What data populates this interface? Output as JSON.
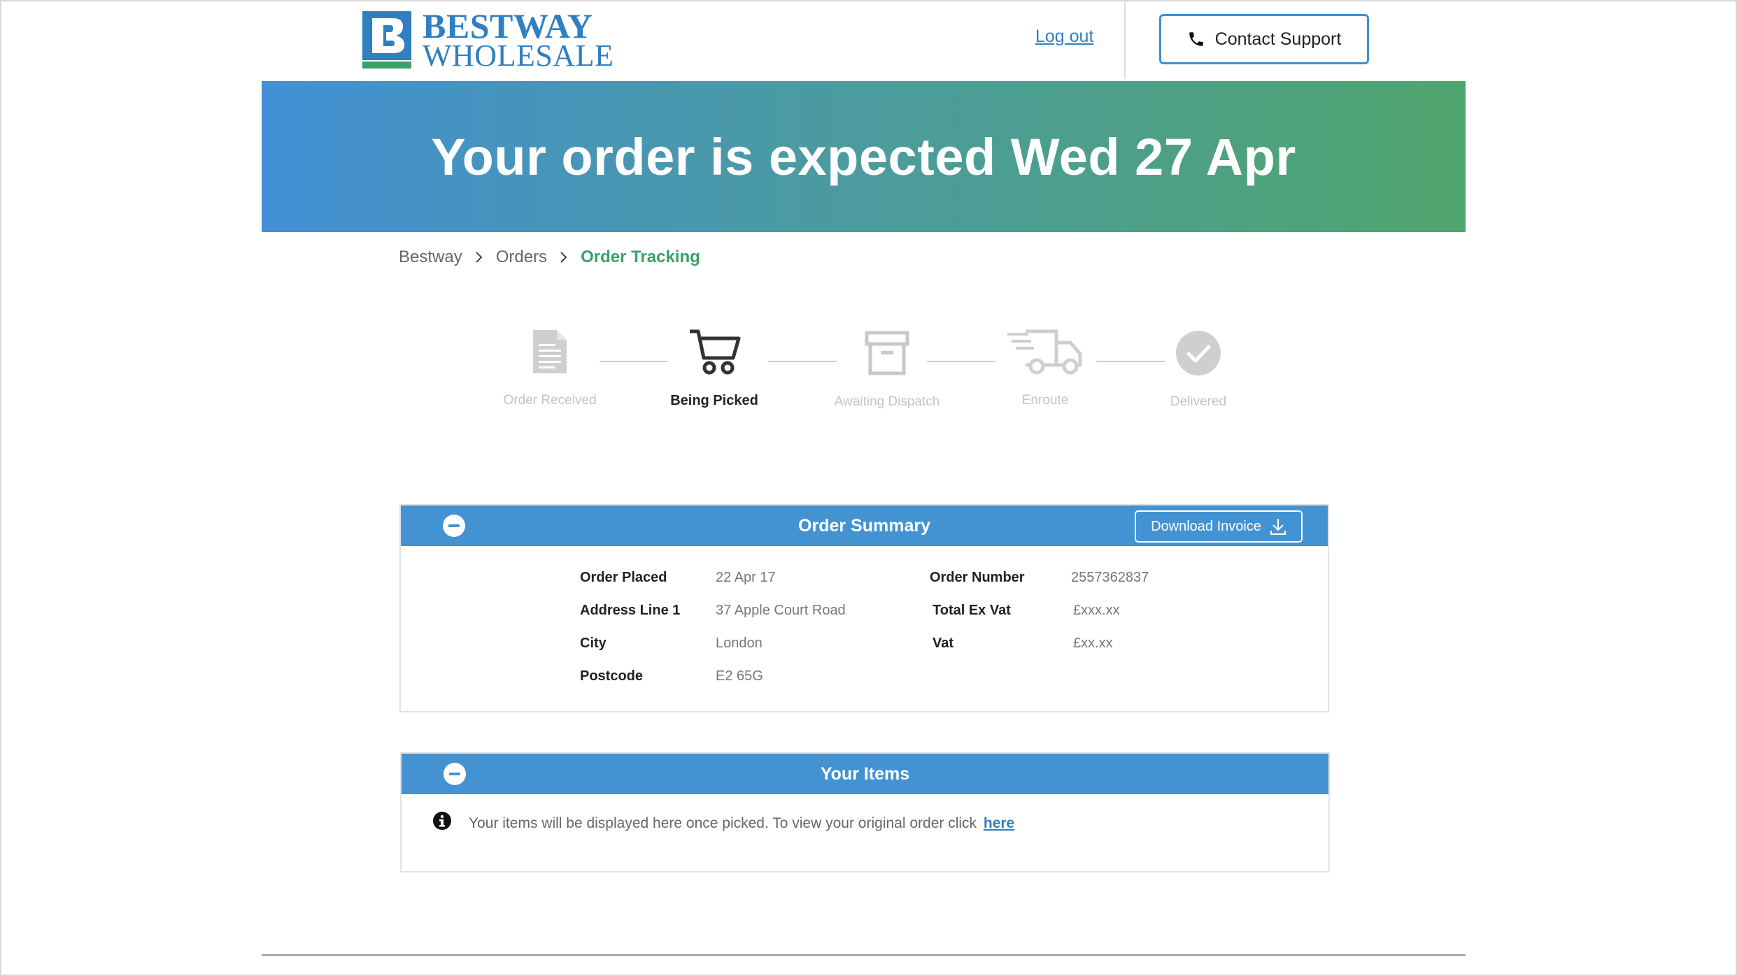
{
  "header": {
    "logo_line1": "BESTWAY",
    "logo_line2": "WHOLESALE",
    "logout_label": "Log out",
    "contact_label": "Contact Support"
  },
  "banner": {
    "title": "Your order is expected Wed 27 Apr"
  },
  "breadcrumb": {
    "items": [
      "Bestway",
      "Orders",
      "Order Tracking"
    ]
  },
  "tracker": {
    "current_step": "Being Picked",
    "steps": [
      {
        "label": "Order Received",
        "icon": "document-icon",
        "state": "inactive"
      },
      {
        "label": "Being Picked",
        "icon": "cart-icon",
        "state": "current"
      },
      {
        "label": "Awaiting Dispatch",
        "icon": "archive-box-icon",
        "state": "inactive"
      },
      {
        "label": "Enroute",
        "icon": "delivery-truck-icon",
        "state": "inactive"
      },
      {
        "label": "Delivered",
        "icon": "checkmark-circle-icon",
        "state": "inactive"
      }
    ]
  },
  "order_summary": {
    "title": "Order Summary",
    "download_label": "Download Invoice",
    "left": [
      {
        "label": "Order Placed",
        "value": "22 Apr 17"
      },
      {
        "label": "Address Line 1",
        "value": "37 Apple Court Road"
      },
      {
        "label": "City",
        "value": "London"
      },
      {
        "label": "Postcode",
        "value": "E2 65G"
      }
    ],
    "right": [
      {
        "label": "Order Number",
        "value": "2557362837"
      },
      {
        "label": "Total Ex Vat",
        "value": "£xxx.xx"
      },
      {
        "label": "Vat",
        "value": "£xx.xx"
      }
    ]
  },
  "your_items": {
    "title": "Your Items",
    "message": "Your items will be displayed here once picked.  To view your original order click",
    "link_label": "here"
  },
  "colors": {
    "brand_blue": "#2f7fc1",
    "panel_blue": "#4393d2",
    "brand_green": "#3aa067",
    "banner_start": "#428fd4",
    "banner_end": "#4fa56d"
  }
}
